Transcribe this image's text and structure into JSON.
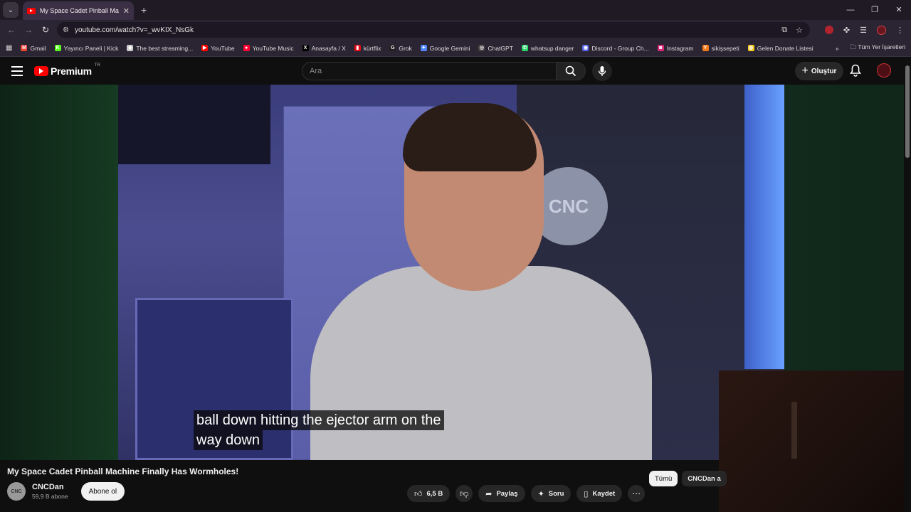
{
  "browser": {
    "tab_title": "My Space Cadet Pinball Machine Finally Has Wormholes!",
    "url": "youtube.com/watch?v=_wvKIX_NsGk",
    "bookmarks": [
      {
        "label": "Gmail",
        "color": "#ea4335",
        "glyph": "M"
      },
      {
        "label": "Yayıncı Paneli | Kick",
        "color": "#53fc18",
        "glyph": "K"
      },
      {
        "label": "The best streaming...",
        "color": "#cccccc",
        "glyph": "◆"
      },
      {
        "label": "YouTube",
        "color": "#ff0000",
        "glyph": "▶"
      },
      {
        "label": "YouTube Music",
        "color": "#ff0033",
        "glyph": "●"
      },
      {
        "label": "Anasayfa / X",
        "color": "#000000",
        "glyph": "X"
      },
      {
        "label": "kürtflix",
        "color": "#e50914",
        "glyph": "▮"
      },
      {
        "label": "Grok",
        "color": "#222222",
        "glyph": "G"
      },
      {
        "label": "Google Gemini",
        "color": "#4e86f8",
        "glyph": "✦"
      },
      {
        "label": "ChatGPT",
        "color": "#444444",
        "glyph": "◎"
      },
      {
        "label": "whatsup danger",
        "color": "#25d366",
        "glyph": "✆"
      },
      {
        "label": "Discord - Group Ch...",
        "color": "#5865f2",
        "glyph": "◉"
      },
      {
        "label": "Instagram",
        "color": "#d62976",
        "glyph": "◙"
      },
      {
        "label": "sikişsepeti",
        "color": "#f27a1a",
        "glyph": "Y"
      },
      {
        "label": "Gelen Donate Listesi",
        "color": "#f5c518",
        "glyph": "◍"
      }
    ],
    "bookmarks_overflow": "»",
    "all_bookmarks": "Tüm Yer İşaretleri"
  },
  "youtube": {
    "logo_text": "Premium",
    "region": "TR",
    "search_placeholder": "Ara",
    "create_label": "Oluştur",
    "caption_line1": "ball down hitting the ejector arm on the",
    "caption_line2": "way down",
    "video_title": "My Space Cadet Pinball Machine Finally Has Wormholes!",
    "channel_name": "CNCDan",
    "channel_subs": "59,9 B abone",
    "subscribe_label": "Abone ol",
    "like_count": "6,5 B",
    "share_label": "Paylaş",
    "ask_label": "Soru",
    "save_label": "Kaydet",
    "chips": [
      "Tümü",
      "CNCDan a"
    ],
    "avatar_initials": "CNC",
    "sign_text": "CNC"
  }
}
